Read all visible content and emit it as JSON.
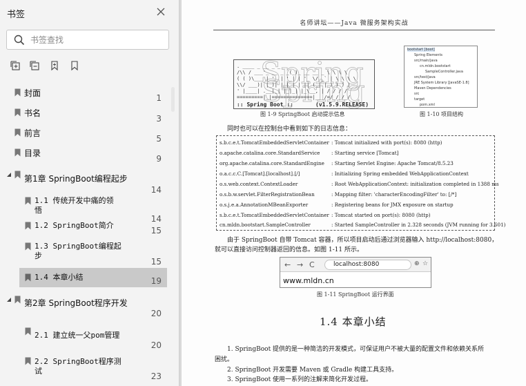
{
  "sidebar": {
    "title": "书签",
    "search_placeholder": "书签查找",
    "bookmarks": [
      {
        "label": "封面",
        "page": "1"
      },
      {
        "label": "书名",
        "page": "3"
      },
      {
        "label": "前言",
        "page": "5"
      },
      {
        "label": "目录",
        "page": "9"
      },
      {
        "label": "第1章 SpringBoot编程起步",
        "page": "14"
      },
      {
        "label1": "1.1 传统开发中痛的领",
        "label2": "悟",
        "page": "14"
      },
      {
        "label": "1.2 SpringBoot简介",
        "page": "15"
      },
      {
        "label1": "1.3 SpringBoot编程起",
        "label2": "步",
        "page": "15"
      },
      {
        "label": "1.4 本章小结",
        "page": "19"
      },
      {
        "label": "第2章 SpringBoot程序开发",
        "page": "20"
      },
      {
        "label": "2.1 建立统一父pom管理",
        "page": "20"
      },
      {
        "label1": "2.2 SpringBoot程序测",
        "label2": "试",
        "page": "23"
      }
    ]
  },
  "document": {
    "header": "名师讲坛——Java 微服务架构实战",
    "fig9": {
      "banner": ":: Spring Boot ::",
      "version": "(v1.5.9.RELEASE)",
      "caption": "图 1-9    SpringBoot 启动提示信息"
    },
    "fig10": {
      "tree": [
        "bootstart [boot]",
        "Spring Elements",
        "src/main/java",
        "cn.mldn.bootstart",
        "SampleController.java",
        "src/test/java",
        "JRE System Library [JavaSE-1.8]",
        "Maven Dependencies",
        "src",
        "target",
        "pom.xml"
      ],
      "caption": "图 1-10    项目结构"
    },
    "intro": "同时也可以在控制台中看到如下的日志信息：",
    "log_rows": [
      {
        "left": "s.b.c.e.t.TomcatEmbeddedServletContainer",
        "right": ": Tomcat initialized with port(s): 8080 (http)"
      },
      {
        "left": "o.apache.catalina.core.StandardService",
        "right": ": Starting service [Tomcat]"
      },
      {
        "left": "org.apache.catalina.core.StandardEngine",
        "right": ": Starting Servlet Engine: Apache Tomcat/8.5.23"
      },
      {
        "left": "o.a.c.c.C.[Tomcat].[localhost].[/]",
        "right": ": Initializing Spring embedded WebApplicationContext"
      },
      {
        "left": "o.s.web.context.ContextLoader",
        "right": ": Root WebApplicationContext: initialization completed in 1388 ms"
      },
      {
        "left": "o.s.b.w.servlet.FilterRegistrationBean",
        "right": ": Mapping filter: 'characterEncodingFilter' to: [/*]"
      },
      {
        "left": "o.s.j.e.a.AnnotationMBeanExporter",
        "right": ": Registering beans for JMX exposure on startup"
      },
      {
        "left": "s.b.c.e.t.TomcatEmbeddedServletContainer",
        "right": ": Tomcat started on port(s): 8080 (http)"
      },
      {
        "left": "cn.mldn.bootstart.SampleController",
        "right": ": Started SampleController in 2.328 seconds (JVM running for 3.601)"
      }
    ],
    "para1_line1": "由于 SpringBoot 自带 Tomcat 容器，所以项目启动后通过浏览器输入 http://localhost:8080，",
    "para1_line2": "就可以直接访问控制器返回的信息。如图 1-11 所示。",
    "fig11": {
      "url": "localhost:8080",
      "page_text": "www.mldn.cn",
      "caption": "图 1-11    SpringBoot 运行界面"
    },
    "section_title": "1.4    本章小结",
    "items": [
      "1. SpringBoot 提供的是一种简洁的开发模式，可保证用户不被大量的配置文件和依赖关系所",
      "困扰。",
      "2. SpringBoot 开发需要 Maven 或 Gradle 构建工具支持。",
      "3. SpringBoot 使用一系列的注解来简化开发过程。"
    ]
  },
  "colors": {
    "sidebar_bg": "#f3f3f3",
    "selected_bg": "#c9c9c9",
    "viewer_bg": "#d9d9d9"
  }
}
